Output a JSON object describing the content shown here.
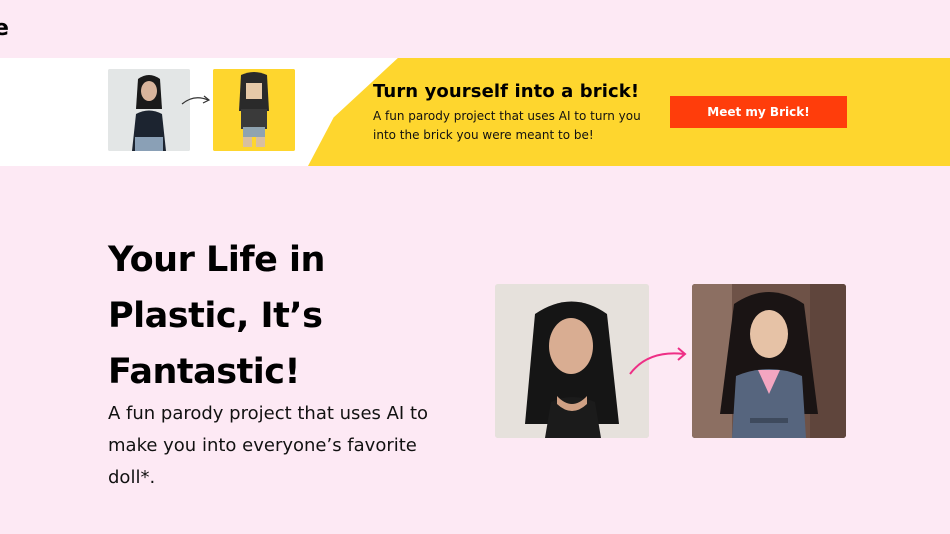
{
  "header": {
    "logo_text": "e"
  },
  "banner": {
    "title": "Turn yourself into a brick!",
    "subtitle": "A fun parody project that uses AI to turn you into the brick you were meant to be!",
    "button_label": "Meet my Brick!",
    "colors": {
      "yellow": "#fed62e",
      "button": "#ff3d0b"
    }
  },
  "hero": {
    "title": "Your Life in Plastic, It’s Fantastic!",
    "subtitle": "A fun parody project that uses AI to make you into everyone’s favorite doll*.",
    "arrow_color": "#ee2f86"
  }
}
